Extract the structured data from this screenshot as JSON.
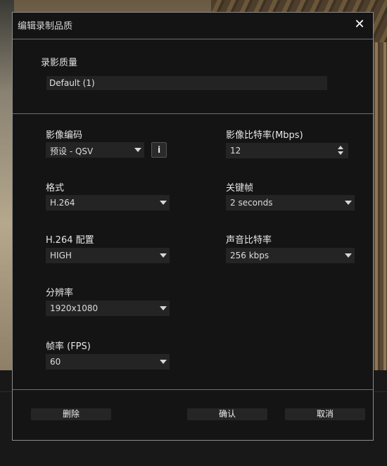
{
  "dialog": {
    "title": "编辑录制品质",
    "close_glyph": "✕"
  },
  "quality": {
    "label": "录影质量",
    "value": "Default (1)"
  },
  "fields": {
    "video_encoder": {
      "label": "影像编码",
      "value": "预设 - QSV",
      "info_glyph": "i"
    },
    "video_bitrate": {
      "label": "影像比特率(Mbps)",
      "value": "12"
    },
    "format": {
      "label": "格式",
      "value": "H.264"
    },
    "keyframe": {
      "label": "关键帧",
      "value": "2 seconds"
    },
    "profile": {
      "label": "H.264 配置",
      "value": "HIGH"
    },
    "audio_bitrate": {
      "label": "声音比特率",
      "value": "256 kbps"
    },
    "resolution": {
      "label": "分辨率",
      "value": "1920x1080"
    },
    "framerate": {
      "label": "帧率 (FPS)",
      "value": "60"
    }
  },
  "buttons": {
    "delete": "删除",
    "confirm": "确认",
    "cancel": "取消"
  },
  "icons": {
    "close": "close-icon",
    "dropdown": "chevron-down-icon",
    "info": "info-icon",
    "stepper": "stepper-arrows-icon"
  }
}
